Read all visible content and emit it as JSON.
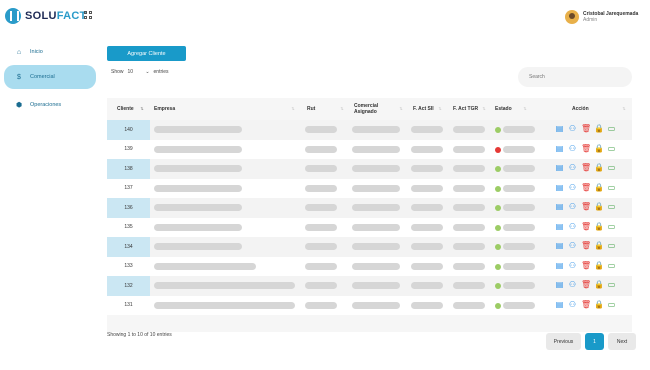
{
  "header": {
    "brand_prefix": "SOLU",
    "brand_suffix": "FACT",
    "apps_icon": "grid-icon",
    "user": {
      "name": "Cristobal Jarequemada",
      "role": "Admin"
    }
  },
  "sidebar": {
    "items": [
      {
        "label": "Inicio",
        "icon": "home-icon",
        "active": false
      },
      {
        "label": "Comercial",
        "icon": "dollar-icon",
        "active": true
      },
      {
        "label": "Operaciones",
        "icon": "box-icon",
        "active": false
      }
    ]
  },
  "toolbar": {
    "add_label": "Agregar Cliente",
    "show_label": "Show",
    "show_value": "10",
    "entries_label": "entries",
    "search_placeholder": "Search"
  },
  "table": {
    "columns": [
      "Cliente",
      "Empresa",
      "Rut",
      "Comercial Asignado",
      "F. Act SII",
      "F. Act TGR",
      "Estado",
      "Acción"
    ],
    "rows": [
      {
        "id": "140",
        "status": "green"
      },
      {
        "id": "139",
        "status": "red"
      },
      {
        "id": "138",
        "status": "green"
      },
      {
        "id": "137",
        "status": "green"
      },
      {
        "id": "136",
        "status": "green"
      },
      {
        "id": "135",
        "status": "green"
      },
      {
        "id": "134",
        "status": "green"
      },
      {
        "id": "133",
        "status": "green"
      },
      {
        "id": "132",
        "status": "green"
      },
      {
        "id": "131",
        "status": "green"
      }
    ],
    "action_icons": [
      "edit-document-icon",
      "user-icon",
      "trash-icon",
      "lock-icon",
      "card-icon"
    ]
  },
  "footer": {
    "info": "Showing 1 to 10 of 10 entries",
    "previous": "Previous",
    "current_page": "1",
    "next": "Next"
  },
  "colors": {
    "accent": "#199ac9",
    "active_nav": "#a9dcef",
    "status_ok": "#9ccc65",
    "status_error": "#e53935"
  }
}
